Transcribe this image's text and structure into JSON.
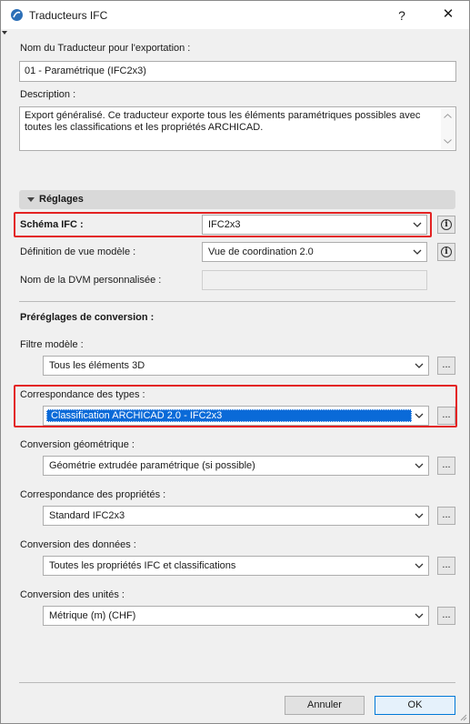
{
  "window": {
    "title": "Traducteurs IFC",
    "help_glyph": "?",
    "close_glyph": "✕"
  },
  "export_translator": {
    "name_label": "Nom du Traducteur pour l'exportation :",
    "name_value": "01 - Paramétrique (IFC2x3)",
    "description_label": "Description :",
    "description_value": "Export généralisé. Ce traducteur exporte tous les éléments paramétriques possibles avec toutes les classifications et les propriétés ARCHICAD."
  },
  "settings": {
    "section_title": "Réglages",
    "ifc_schema_label": "Schéma IFC :",
    "ifc_schema_value": "IFC2x3",
    "mvd_label": "Définition de vue modèle :",
    "mvd_value": "Vue de coordination 2.0",
    "custom_mvd_label": "Nom de la DVM personnalisée :",
    "custom_mvd_value": "",
    "info_glyph": "i"
  },
  "conversion": {
    "title": "Préréglages de conversion :",
    "dots": "...",
    "rows": [
      {
        "label": "Filtre modèle :",
        "value": "Tous les éléments 3D"
      },
      {
        "label": "Correspondance des types :",
        "value": "Classification ARCHICAD 2.0 - IFC2x3"
      },
      {
        "label": "Conversion géométrique :",
        "value": "Géométrie extrudée paramétrique (si possible)"
      },
      {
        "label": "Correspondance des propriétés :",
        "value": "Standard IFC2x3"
      },
      {
        "label": "Conversion des données :",
        "value": "Toutes les propriétés IFC et classifications"
      },
      {
        "label": "Conversion des unités :",
        "value": "Métrique (m) (CHF)"
      }
    ]
  },
  "footer": {
    "cancel_label": "Annuler",
    "ok_label": "OK"
  },
  "colors": {
    "highlight_box": "#e32222",
    "selection": "#0a6ad8"
  }
}
